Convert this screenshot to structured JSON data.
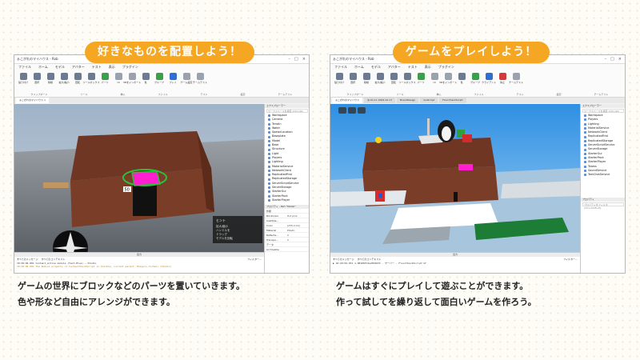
{
  "left": {
    "banner": "好きなものを配置しよう！",
    "window": {
      "title": "ぁこがれのマイハウス - Rob",
      "user": "Rochsol_rbtnx",
      "menu": [
        "ファイル",
        "ホーム",
        "モデル",
        "アバター",
        "テスト",
        "表示",
        "プラグイン"
      ],
      "ribbon_buttons": [
        {
          "label": "貼り付け",
          "icon": "paste-icon"
        },
        {
          "label": "選択",
          "icon": "cursor-icon"
        },
        {
          "label": "移動",
          "icon": "move-icon"
        },
        {
          "label": "拡大/縮小",
          "icon": "scale-icon"
        },
        {
          "label": "回転",
          "icon": "rotate-icon"
        },
        {
          "label": "ツールボックス",
          "icon": "toolbox-icon"
        },
        {
          "label": "パーツ",
          "icon": "part-icon"
        },
        {
          "label": "UI",
          "icon": "ui-icon"
        },
        {
          "label": "3Dをインポート",
          "icon": "import-icon"
        },
        {
          "label": "色",
          "icon": "color-icon"
        },
        {
          "label": "グループ",
          "icon": "group-icon"
        },
        {
          "label": "プレイ",
          "icon": "play-icon"
        },
        {
          "label": "ゲーム設定",
          "icon": "settings-icon"
        },
        {
          "label": "チームテスト",
          "icon": "team-test-icon"
        }
      ],
      "ribbon_groups": [
        "クリップボード",
        "ツール",
        "挿入",
        "ファイル",
        "テスト",
        "設定",
        "チームテスト"
      ],
      "tabs": [
        "ぁこがれのマイハウス ×"
      ],
      "explorer_title": "エクスプローラー",
      "explorer_search": "ワークスペースを検索 (Ctrl+Shi",
      "tree": [
        "Workspace",
        "Camera",
        "Terrain",
        "Water",
        "SpawnLocation",
        "Baseplate",
        "Model",
        "Base",
        "Structure",
        "Light",
        "Players",
        "Lighting",
        "MaterialService",
        "NetworkClient",
        "ReplicatedFirst",
        "ReplicatedStorage",
        "ServerScriptService",
        "ServerStorage",
        "StarterGui",
        "StarterPack",
        "StarterPlayer"
      ],
      "properties_title": "プロパティ - Part \"Model\"",
      "properties": [
        {
          "name": "外観",
          "value": ""
        },
        {
          "name": "BrickColor",
          "value": "Hot pink"
        },
        {
          "name": "CastSha...",
          "value": ""
        },
        {
          "name": "Color",
          "value": "[255,0,19]"
        },
        {
          "name": "Material",
          "value": "Plastic"
        },
        {
          "name": "Reflecta...",
          "value": "0"
        },
        {
          "name": "Transpa...",
          "value": "0"
        },
        {
          "name": "データ",
          "value": ""
        },
        {
          "name": "Archivable",
          "value": ""
        }
      ],
      "output_title": "出力",
      "output_filters": [
        "すべてのメッセージ",
        "すべてのコンテキスト",
        "フィルター..."
      ],
      "output_lines": [
        {
          "text": "10:29:04.091  Content_active module (Text-Plus) — Studio",
          "color": "#333"
        },
        {
          "text": "10:29:04.091  The Roblox property of ContextCheckScript is Visible; current parent: Players.rochsol (Studio)",
          "color": "#c77d00"
        }
      ],
      "label_tag": "50",
      "hint_title": "ヒント",
      "hint_lines": [
        "拡大/縮小",
        "ハンドルを",
        "ドラッグ",
        "モデルを回転"
      ]
    }
  },
  "right": {
    "banner": "ゲームをプレイしよう！",
    "window": {
      "title": "ぁこがれのマイハウス - Rob",
      "user": "Rochsol_rbtnx",
      "menu": [
        "ファイル",
        "ホーム",
        "モデル",
        "アバター",
        "テスト",
        "表示",
        "プラグイン"
      ],
      "ribbon_buttons": [
        {
          "label": "貼り付け",
          "icon": "paste-icon"
        },
        {
          "label": "選択",
          "icon": "cursor-icon"
        },
        {
          "label": "移動",
          "icon": "move-icon"
        },
        {
          "label": "拡大/縮小",
          "icon": "scale-icon"
        },
        {
          "label": "回転",
          "icon": "rotate-icon"
        },
        {
          "label": "ツールボックス",
          "icon": "toolbox-icon"
        },
        {
          "label": "パーツ",
          "icon": "part-icon"
        },
        {
          "label": "UI",
          "icon": "ui-icon"
        },
        {
          "label": "3Dをインポート",
          "icon": "import-icon"
        },
        {
          "label": "色",
          "icon": "color-icon"
        },
        {
          "label": "グループ",
          "icon": "group-icon"
        },
        {
          "label": "クライアント",
          "icon": "client-icon"
        },
        {
          "label": "停止",
          "icon": "stop-icon"
        },
        {
          "label": "チームテスト",
          "icon": "team-test-icon"
        }
      ],
      "ribbon_groups": [
        "クリップボード",
        "ツール",
        "挿入",
        "ファイル",
        "テスト",
        "設定",
        "チームテスト"
      ],
      "tabs": [
        "ぁこがれのマイハウス",
        "@-01-11 2024-10-17",
        "BoardDesign",
        "GuiScript",
        "FloorCheckScript"
      ],
      "explorer_title": "エクスプローラー",
      "explorer_search": "ワークスペースを検索 (Ctrl+Shi",
      "tree": [
        "Workspace",
        "Players",
        "Lighting",
        "MaterialService",
        "NetworkClient",
        "ReplicatedFirst",
        "ReplicatedStorage",
        "ServerScriptService",
        "ServerStorage",
        "StarterGui",
        "StarterPack",
        "StarterPlayer",
        "Teams",
        "SoundService",
        "TextChatService"
      ],
      "properties_title": "プロパティ",
      "properties_search": "プロパティをフィルタ (Ctrl+Shift+P)",
      "output_title": "出力",
      "output_filters": [
        "すべてのメッセージ",
        "すべてのコンテキスト",
        "フィルター..."
      ],
      "output_lines": [
        {
          "text": "▶ 10:29:04.031  1.08106574e2034933 - サーバー - FloorCheckScript:17",
          "color": "#333"
        }
      ]
    }
  },
  "captions": {
    "left": [
      "ゲームの世界にブロックなどのパーツを置いていきます。",
      "色や形など自由にアレンジができます。"
    ],
    "right": [
      "ゲームはすぐにプレイして遊ぶことができます。",
      "作って試してを繰り返して面白いゲームを作ろう。"
    ]
  },
  "colors": {
    "banner": "#f5a623",
    "house_wood": "#7a3d27",
    "selection_green": "#2dbf3a",
    "hot_pink": "#ff1fd0",
    "sky_left": "#9fb3c8",
    "sky_right": "#2f8fe2"
  }
}
